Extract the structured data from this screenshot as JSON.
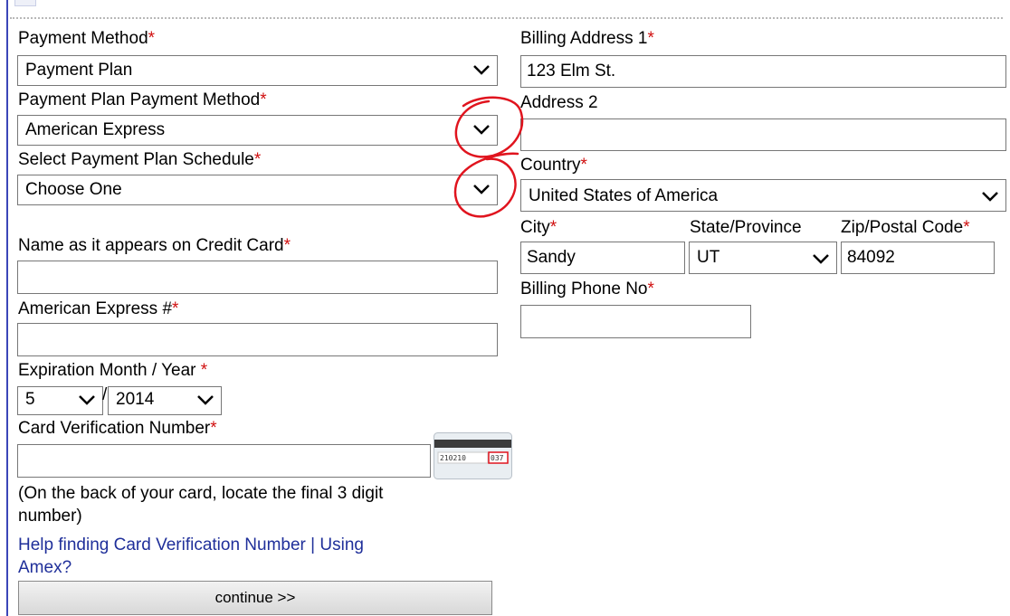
{
  "left": {
    "payment_method": {
      "label": "Payment Method",
      "req": "*",
      "value": "Payment Plan"
    },
    "plan_method": {
      "label": "Payment Plan Payment Method",
      "req": "*",
      "value": "American Express"
    },
    "plan_schedule": {
      "label": "Select Payment Plan Schedule",
      "req": "*",
      "value": "Choose One"
    },
    "name_on_card": {
      "label": "Name as it appears on Credit Card",
      "req": "*",
      "value": ""
    },
    "card_number": {
      "label": "American Express #",
      "req": "*",
      "value": ""
    },
    "expiration": {
      "label": "Expiration Month / Year ",
      "req": "*",
      "month": "5",
      "separator": "/",
      "year": "2014"
    },
    "cvn": {
      "label": "Card Verification Number",
      "req": "*",
      "value": ""
    },
    "cvn_hint_1": "(On the back of your card, locate the final 3 digit",
    "cvn_hint_2": "number)",
    "help_link": "Help finding Card Verification Number",
    "link_separator": "|",
    "amex_link_1": "Using",
    "amex_link_2": "Amex?",
    "continue_label": "continue >>"
  },
  "right": {
    "address1": {
      "label": "Billing Address 1",
      "req": "*",
      "value": "123 Elm St."
    },
    "address2": {
      "label": "Address 2",
      "value": ""
    },
    "country": {
      "label": "Country",
      "req": "*",
      "value": "United States of America"
    },
    "city": {
      "label": "City",
      "req": "*",
      "value": "Sandy"
    },
    "state": {
      "label": "State/Province",
      "value": "UT"
    },
    "zip": {
      "label": "Zip/Postal Code",
      "req": "*",
      "value": "84092"
    },
    "phone": {
      "label": "Billing Phone No",
      "req": "*",
      "value": ""
    }
  },
  "card_image": {
    "digits": "210210",
    "code": "037"
  },
  "icons": {
    "dropdown": "chevron-down-icon",
    "annotation": "red-circle-annotation"
  },
  "colors": {
    "required": "#d01010",
    "link": "#1f2f9a",
    "annotation": "#e0141e",
    "frame_line": "#3b46b8"
  }
}
